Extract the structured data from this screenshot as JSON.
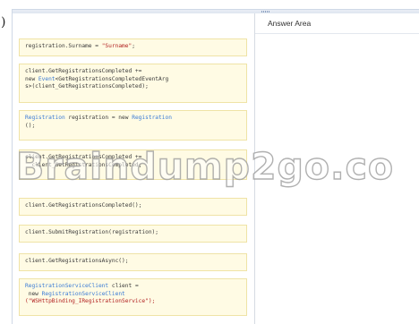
{
  "answer_area": {
    "title": "Answer Area"
  },
  "snippets": [
    {
      "line1": "registration.Surname = ",
      "str": "\"Surname\"",
      "tail": ";"
    },
    {
      "line1": "client.GetRegistrationsCompleted +=",
      "kw_prefix": "new ",
      "kw": "Event",
      "line2": "<GetRegistrationsCompletedEventArg",
      "line3": "s>(client_GetRegistrationsCompleted);"
    },
    {
      "kw1": "Registration",
      "mid": " registration = new ",
      "kw2": "Registration",
      "line2": "();"
    },
    {
      "line1": "client.GetRegistrationsCompleted +=",
      "line2": "  client_GetRegistrationsCompleted;"
    },
    {
      "line1": "client.GetRegistrationsCompleted();"
    },
    {
      "line1": "client.SubmitRegistration(registration);"
    },
    {
      "line1": "client.GetRegistrationsAsync();"
    },
    {
      "kw1": "RegistrationServiceClient",
      "line1": " client =",
      "line2_prefix": " new ",
      "kw2": "RegistrationServiceClient",
      "str": "(\"WSHttpBinding_IRegistrationService\");"
    }
  ],
  "watermark": {
    "text": "Braindump2go.co"
  },
  "header_fragment": {
    "text": ")"
  }
}
